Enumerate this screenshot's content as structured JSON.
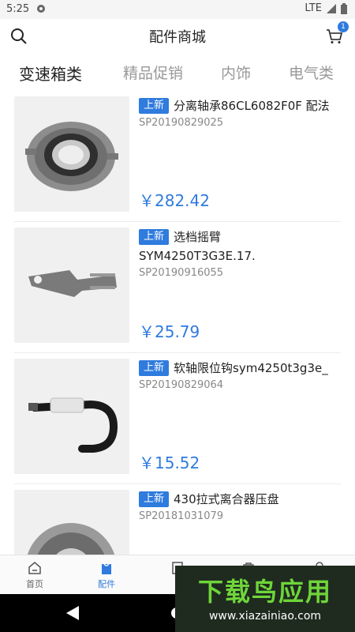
{
  "status_bar": {
    "time": "5:25",
    "network": "LTE"
  },
  "header": {
    "title": "配件商城",
    "cart_badge": "1"
  },
  "tabs": [
    {
      "label": "变速箱类",
      "active": true
    },
    {
      "label": "精品促销",
      "active": false
    },
    {
      "label": "内饰",
      "active": false
    },
    {
      "label": "电气类",
      "active": false
    }
  ],
  "products": [
    {
      "tag": "上新",
      "name": "分离轴承86CL6082F0F 配法",
      "name2": "",
      "sku": "SP20190829025",
      "price": "￥282.42",
      "image": "release-bearing"
    },
    {
      "tag": "上新",
      "name": "选档摇臂",
      "name2": "SYM4250T3G3E.17.",
      "sku": "SP20190916055",
      "price": "￥25.79",
      "image": "shift-arm"
    },
    {
      "tag": "上新",
      "name": "软轴限位钩sym4250t3g3e_",
      "name2": "",
      "sku": "SP20190829064",
      "price": "￥15.52",
      "image": "cable-hook"
    },
    {
      "tag": "上新",
      "name": "430拉式离合器压盘",
      "name2": "",
      "sku": "SP20181031079",
      "price": "",
      "image": "pressure-plate"
    }
  ],
  "bottom_nav": [
    {
      "label": "首页",
      "icon": "home-icon",
      "active": false
    },
    {
      "label": "配件",
      "icon": "parts-icon",
      "active": true
    },
    {
      "label": "",
      "icon": "category-icon",
      "active": false
    },
    {
      "label": "",
      "icon": "bag-icon",
      "active": false
    },
    {
      "label": "",
      "icon": "profile-icon",
      "active": false
    }
  ],
  "watermark": {
    "big": "下载鸟应用",
    "small": "www.xiazainiao.com"
  },
  "colors": {
    "accent": "#2f7bde",
    "watermark_green": "#6fd53a"
  }
}
